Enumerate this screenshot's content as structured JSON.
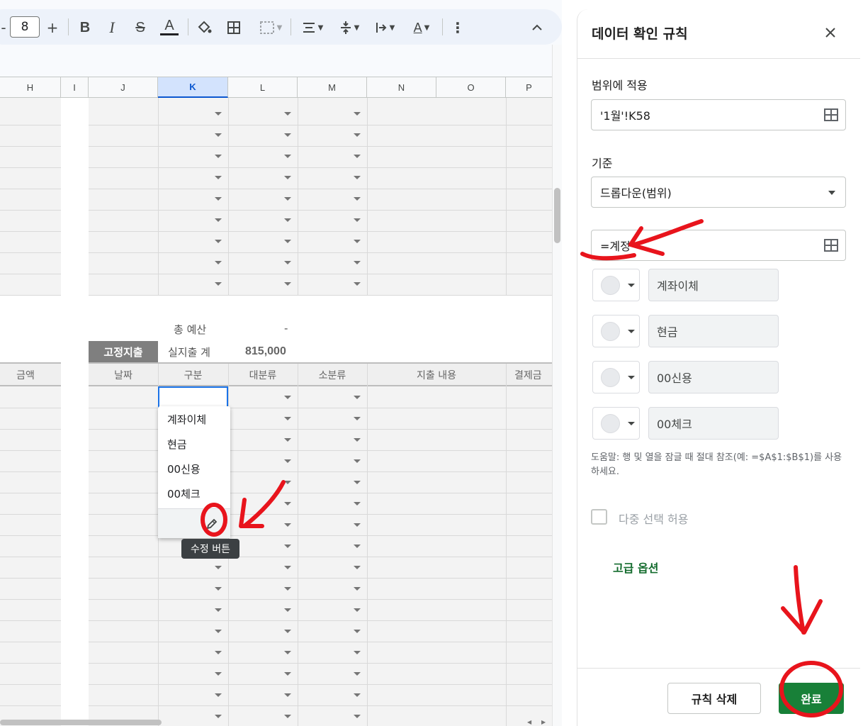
{
  "toolbar": {
    "font_size": "8",
    "plus": "+",
    "bold": "B",
    "italic": "I",
    "strike": "S",
    "text_color": "A",
    "more": "⋮",
    "collapse": "^"
  },
  "columns": [
    "H",
    "I",
    "J",
    "K",
    "L",
    "M",
    "N",
    "O",
    "P"
  ],
  "summary": {
    "total_budget_label": "총 예산",
    "total_budget_value": "-",
    "fixed_tag": "고정지출",
    "actual_total_label": "실지출 계",
    "actual_total_value": "815,000"
  },
  "table_headers": {
    "amount": "금액",
    "date": "날짜",
    "type": "구분",
    "major": "대분류",
    "minor": "소분류",
    "content": "지출 내용",
    "payment": "결제금"
  },
  "dropdown": {
    "items": [
      "계좌이체",
      "현금",
      "00신용",
      "00체크"
    ],
    "tooltip": "수정 버튼"
  },
  "panel": {
    "title": "데이터 확인 규칙",
    "apply_range_label": "범위에 적용",
    "apply_range_value": "'1월'!K58",
    "criteria_label": "기준",
    "criteria_value": "드롭다운(범위)",
    "range_value": "=계정",
    "options": [
      "계좌이체",
      "현금",
      "00신용",
      "00체크"
    ],
    "help_text": "도움말: 행 및 열을 잠글 때 절대 참조(예: =$A$1:$B$1)를 사용하세요.",
    "multi_select_label": "다중 선택 허용",
    "advanced_label": "고급 옵션",
    "delete_button": "규칙 삭제",
    "done_button": "완료"
  },
  "colors": {
    "accent_green": "#188038",
    "selected_blue": "#1a73e8",
    "annotation_red": "#e8141c"
  }
}
